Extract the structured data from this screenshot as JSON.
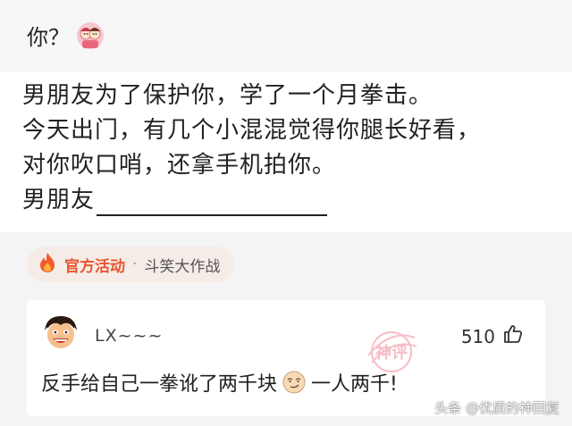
{
  "header": {
    "text": "你？",
    "emoji": "couple-emoji-icon"
  },
  "post": {
    "lines": [
      "男朋友为了保护你，学了一个月拳击。",
      "今天出门，有几个小混混觉得你腿长好看，",
      "对你吹口哨，还拿手机拍你。",
      "男朋友"
    ]
  },
  "activity": {
    "label": "官方活动",
    "separator": "·",
    "topic": "斗笑大作战",
    "icon": "fire-icon"
  },
  "comment": {
    "username": "LX~~~",
    "likes": "510",
    "text_before": "反手给自己一拳讹了两千块",
    "text_after": "一人两千!",
    "stamp": "神评",
    "emoji": "smirk-face-icon"
  },
  "watermark": "头条 @优质的神回复",
  "colors": {
    "accent": "#e8552f",
    "stamp": "#f08a98"
  }
}
